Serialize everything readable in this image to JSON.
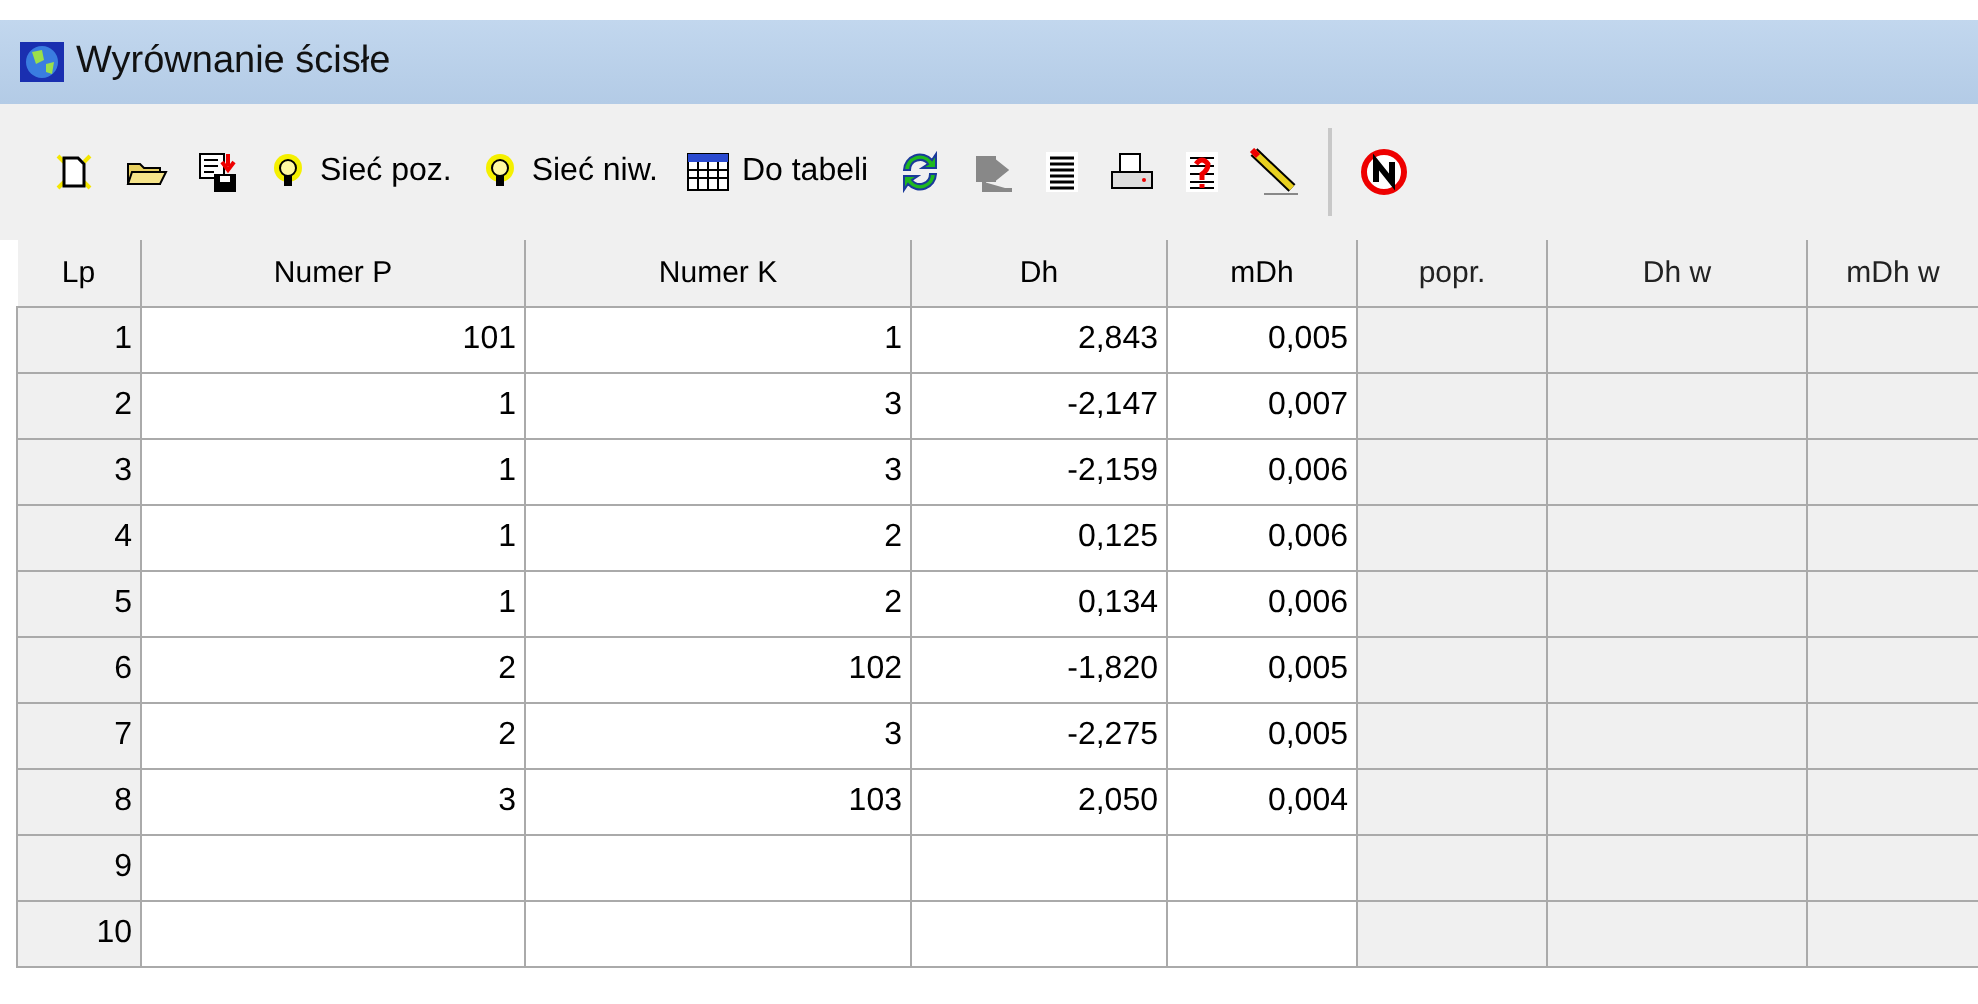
{
  "window": {
    "title": "Wyrównanie ścisłe"
  },
  "toolbar": [
    {
      "kind": "new"
    },
    {
      "kind": "open"
    },
    {
      "kind": "save"
    },
    {
      "kind": "bulb",
      "label": "Sieć poz."
    },
    {
      "kind": "bulb",
      "label": "Sieć niw."
    },
    {
      "kind": "table",
      "label": "Do tabeli"
    },
    {
      "kind": "refresh"
    },
    {
      "kind": "export"
    },
    {
      "kind": "list"
    },
    {
      "kind": "print"
    },
    {
      "kind": "help"
    },
    {
      "kind": "pencil"
    },
    {
      "kind": "sep"
    },
    {
      "kind": "stop"
    }
  ],
  "table": {
    "columns": [
      {
        "label": "Lp",
        "shaded": false
      },
      {
        "label": "Numer P",
        "shaded": false
      },
      {
        "label": "Numer K",
        "shaded": false
      },
      {
        "label": "Dh",
        "shaded": false
      },
      {
        "label": "mDh",
        "shaded": false
      },
      {
        "label": "popr.",
        "shaded": true
      },
      {
        "label": "Dh w",
        "shaded": true
      },
      {
        "label": "mDh w",
        "shaded": true
      }
    ],
    "rows": [
      {
        "lp": "1",
        "cells": [
          "101",
          "1",
          "2,843",
          "0,005"
        ]
      },
      {
        "lp": "2",
        "cells": [
          "1",
          "3",
          "-2,147",
          "0,007"
        ]
      },
      {
        "lp": "3",
        "cells": [
          "1",
          "3",
          "-2,159",
          "0,006"
        ]
      },
      {
        "lp": "4",
        "cells": [
          "1",
          "2",
          "0,125",
          "0,006"
        ]
      },
      {
        "lp": "5",
        "cells": [
          "1",
          "2",
          "0,134",
          "0,006"
        ]
      },
      {
        "lp": "6",
        "cells": [
          "2",
          "102",
          "-1,820",
          "0,005"
        ]
      },
      {
        "lp": "7",
        "cells": [
          "2",
          "3",
          "-2,275",
          "0,005"
        ]
      },
      {
        "lp": "8",
        "cells": [
          "3",
          "103",
          "2,050",
          "0,004"
        ]
      },
      {
        "lp": "9"
      },
      {
        "lp": "10"
      }
    ]
  }
}
